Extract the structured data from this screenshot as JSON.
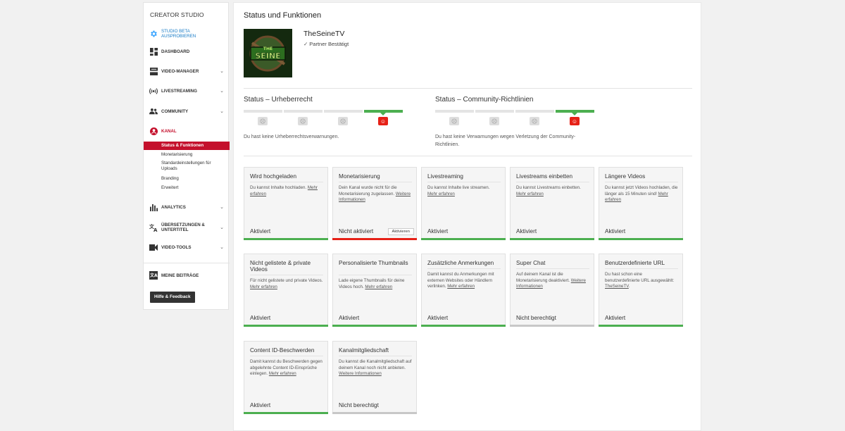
{
  "sidebar": {
    "title": "CREATOR STUDIO",
    "items": [
      {
        "label": "STUDIO BETA AUSPROBIEREN",
        "icon": "gear-icon"
      },
      {
        "label": "DASHBOARD",
        "icon": "dashboard-icon"
      },
      {
        "label": "VIDEO-MANAGER",
        "icon": "video-manager-icon"
      },
      {
        "label": "LIVESTREAMING",
        "icon": "livestream-icon"
      },
      {
        "label": "COMMUNITY",
        "icon": "community-icon"
      },
      {
        "label": "KANAL",
        "icon": "channel-icon"
      },
      {
        "label": "ANALYTICS",
        "icon": "analytics-icon"
      },
      {
        "label": "ÜBERSETZUNGEN & UNTERTITEL",
        "icon": "translate-icon"
      },
      {
        "label": "VIDEO-TOOLS",
        "icon": "video-tools-icon"
      },
      {
        "label": "MEINE BEITRÄGE",
        "icon": "contributions-icon"
      }
    ],
    "sub_items": [
      "Status & Funktionen",
      "Monetarisierung",
      "Standardeinstellungen für Uploads",
      "Branding",
      "Erweitert"
    ],
    "help_button": "Hilfe & Feedback"
  },
  "main": {
    "title": "Status und Funktionen",
    "channel_name": "TheSeineTV",
    "avatar_text": "THE SEINE",
    "partner_status": "Partner Bestätigt",
    "copyright": {
      "title": "Status – Urheberrecht",
      "text": "Du hast keine Urheberrechtsverwarnungen."
    },
    "community": {
      "title": "Status – Community-Richtlinien",
      "text": "Du hast keine Verwarnungen wegen Verletzung der Community-Richtlinien."
    },
    "cards": [
      {
        "title": "Wird hochgeladen",
        "desc": "Du kannst Inhalte hochladen.",
        "link": "Mehr erfahren",
        "status": "Aktiviert",
        "bar": "green"
      },
      {
        "title": "Monetarisierung",
        "desc": "Dein Kanal wurde nicht für die Monetarisierung zugelassen.",
        "link": "Weitere Informationen",
        "status": "Nicht aktiviert",
        "bar": "red",
        "button": "Aktivieren"
      },
      {
        "title": "Livestreaming",
        "desc": "Du kannst Inhalte live streamen.",
        "link": "Mehr erfahren",
        "status": "Aktiviert",
        "bar": "green"
      },
      {
        "title": "Livestreams einbetten",
        "desc": "Du kannst Livestreams einbetten.",
        "link": "Mehr erfahren",
        "status": "Aktiviert",
        "bar": "green"
      },
      {
        "title": "Längere Videos",
        "desc": "Du kannst jetzt Videos hochladen, die länger als 15 Minuten sind!",
        "link": "Mehr erfahren",
        "status": "Aktiviert",
        "bar": "green"
      },
      {
        "title": "Nicht gelistete & private Videos",
        "desc": "Für nicht gelistete und private Videos.",
        "link": "Mehr erfahren",
        "status": "Aktiviert",
        "bar": "green"
      },
      {
        "title": "Personalisierte Thumbnails",
        "desc": "Lade eigene Thumbnails für deine Videos hoch.",
        "link": "Mehr erfahren",
        "status": "Aktiviert",
        "bar": "green"
      },
      {
        "title": "Zusätzliche Anmerkungen",
        "desc": "Damit kannst du Anmerkungen mit externen Websites oder Händlern verlinken.",
        "link": "Mehr erfahren",
        "status": "Aktiviert",
        "bar": "green"
      },
      {
        "title": "Super Chat",
        "desc": "Auf deinem Kanal ist die Monetarisierung deaktiviert.",
        "link": "Weitere Informationen",
        "status": "Nicht berechtigt",
        "bar": "grey"
      },
      {
        "title": "Benutzerdefinierte URL",
        "desc": "Du hast schon eine benutzerdefinierte URL ausgewählt:",
        "link": "TheSeineTV",
        "suffix": ".",
        "status": "Aktiviert",
        "bar": "green"
      },
      {
        "title": "Content ID-Beschwerden",
        "desc": "Damit kannst du Beschwerden gegen abgelehnte Content ID-Einsprüche einlegen.",
        "link": "Mehr erfahren",
        "status": "Aktiviert",
        "bar": "green"
      },
      {
        "title": "Kanalmitgliedschaft",
        "desc": "Du kannst die Kanalmitgliedschaft auf deinem Kanal noch nicht anbieten.",
        "link": "Weitere Informationen",
        "status": "Nicht berechtigt",
        "bar": "grey"
      }
    ]
  }
}
